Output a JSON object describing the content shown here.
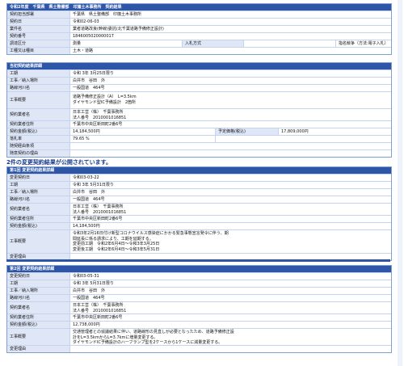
{
  "header": {
    "title": "令和2年度　千葉県　県土整備部　印旛土木事務所　契約結果"
  },
  "info": {
    "rows": [
      {
        "label": "契約担当部署",
        "value": "千葉県　県土整備部　印旛土木事務所"
      },
      {
        "label": "契約日",
        "value": "令和02-06-03"
      },
      {
        "label": "業件名",
        "value": "業者道路改良(幹線)委託(北千葉道路予備修正設計)"
      },
      {
        "label": "契約番号",
        "value": "1846005020000017"
      }
    ],
    "type_row": {
      "label": "調達区分",
      "value": "測量",
      "label2": "入札方式",
      "value2": "",
      "value3": "指名競争（方法:電子入札）"
    },
    "work_row": {
      "label": "工種又は種目",
      "value": "土木・道路"
    }
  },
  "original": {
    "title": "当初契約結果詳細",
    "rows": [
      {
        "label": "工期",
        "value": "令和 3年 3月25日限り"
      },
      {
        "label": "工事／納入場所",
        "value": "白井市　谷田　外"
      },
      {
        "label": "路線河川名",
        "value": "一般国道　464号"
      },
      {
        "label": "工事概要",
        "value": "道路予備修正設計（A）　L=3.5km\nダイヤモンド型IC予備設計　2箇所"
      },
      {
        "label": "契約業者名",
        "value": "日本工営（株）　千葉事務所\n法人番号　2010001016851"
      },
      {
        "label": "契約業者住所",
        "value": "千葉市中央区新田町2番6号"
      }
    ],
    "price_row": {
      "label": "契約金額(税込)",
      "value": "14,184,500円",
      "label2": "予定価格(税込)",
      "value2": "17,809,000円"
    },
    "rate_row": {
      "label": "落札率",
      "value": "79.65 %"
    },
    "extra_rows": [
      {
        "label": "随契経由条項",
        "value": ""
      },
      {
        "label": "随意契約の理由",
        "value": ""
      }
    ]
  },
  "notice": "2件の変更契約結果が公開されています。",
  "change1": {
    "title": "第1回 変更契約結果詳細",
    "rows": [
      {
        "label": "変更契約日",
        "value": "令和03-03-22"
      },
      {
        "label": "工期",
        "value": "令和 3年 5月31日限り"
      },
      {
        "label": "工事／納入場所",
        "value": "白井市　谷田　外"
      },
      {
        "label": "路線河川名",
        "value": "一般国道　464号"
      },
      {
        "label": "契約業者名",
        "value": "日本工営（株）　千葉事務所\n法人番号　2010001016851"
      },
      {
        "label": "契約業者住所",
        "value": "千葉市中央区新田町2番6号"
      },
      {
        "label": "契約金額(税込)",
        "value": "14,184,500円"
      },
      {
        "label": "工事概要",
        "value": "令和3年2月16日付け新型コロナウイルス感染症にかかる緊急事態宣言発令に伴う、期\n間延長に係る請求により、工期を延期する。\n変更前工期　令和2年6月4日～令和3年3月25日\n変更後工期　令和2年6月4日～令和3年5月31日"
      },
      {
        "label": "変更理由",
        "value": ""
      }
    ]
  },
  "change2": {
    "title": "第2回 変更契約結果詳細",
    "rows": [
      {
        "label": "変更契約日",
        "value": "令和03-05-31"
      },
      {
        "label": "工期",
        "value": "令和 3年 5月31日限り"
      },
      {
        "label": "工事／納入場所",
        "value": "白井市　谷田　外"
      },
      {
        "label": "路線河川名",
        "value": "一般国道　464号"
      },
      {
        "label": "契約業者名",
        "value": "日本工営（株）　千葉事務所\n法人番号　2010001016851"
      },
      {
        "label": "契約業者住所",
        "value": "千葉市中央区新田町2番6号"
      },
      {
        "label": "契約金額(税込)",
        "value": "12,738,000円"
      },
      {
        "label": "工事概要",
        "value": "交通管理者との協議結果に伴い、道路線形の見直しが必要となったため、道路予備修正設\n計をL=3.5kmからL=3.7kmに増量変更する。\nダイヤモンドIC予備設計のハーフランプ型を2ケースから1ケースに減量変更する。"
      },
      {
        "label": "変更理由",
        "value": ""
      }
    ]
  }
}
